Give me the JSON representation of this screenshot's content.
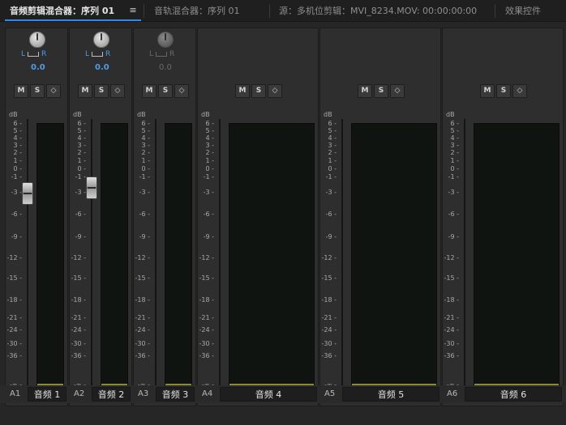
{
  "tabs": {
    "audio_clip_mixer": "音频剪辑混合器：序列 01",
    "menu_glyph": "≡",
    "audio_track_mixer": "音轨混合器：序列 01",
    "source": "源：多机位剪辑：MVI_8234.MOV: 00:00:00:00",
    "effect_controls": "效果控件"
  },
  "meter": {
    "db_label": "dB",
    "scale": [
      "6 -",
      "5 -",
      "4 -",
      "3 -",
      "2 -",
      "1 -",
      "0 -",
      "-1 -",
      "-3 -",
      "-6 -",
      "-9 -",
      "-12 -",
      "-15 -",
      "-18 -",
      "-21 -",
      "-24 -",
      "-30 -",
      "-36 -",
      "-∞ -"
    ]
  },
  "channels": [
    {
      "id": "A1",
      "name": "音频 1",
      "pan_left": "L",
      "pan_right": "R",
      "pan_value": "0.0",
      "volume": "0.0",
      "mute": "M",
      "solo": "S",
      "record_icon": "◇",
      "enabled": true
    },
    {
      "id": "A2",
      "name": "音频 2",
      "pan_left": "L",
      "pan_right": "R",
      "pan_value": "0.0",
      "volume": "0.4",
      "mute": "M",
      "solo": "S",
      "record_icon": "◇",
      "enabled": true
    },
    {
      "id": "A3",
      "name": "音频 3",
      "pan_left": "L",
      "pan_right": "R",
      "pan_value": "0.0",
      "volume": "",
      "mute": "M",
      "solo": "S",
      "record_icon": "◇",
      "enabled": false
    },
    {
      "id": "A4",
      "name": "音频 4",
      "mute": "M",
      "solo": "S",
      "record_icon": "◇"
    },
    {
      "id": "A5",
      "name": "音频 5",
      "mute": "M",
      "solo": "S",
      "record_icon": "◇"
    },
    {
      "id": "A6",
      "name": "音频 6",
      "mute": "M",
      "solo": "S",
      "record_icon": "◇"
    }
  ],
  "colors": {
    "accent": "#4a9de8",
    "meter_floor": "#8a8a32"
  }
}
